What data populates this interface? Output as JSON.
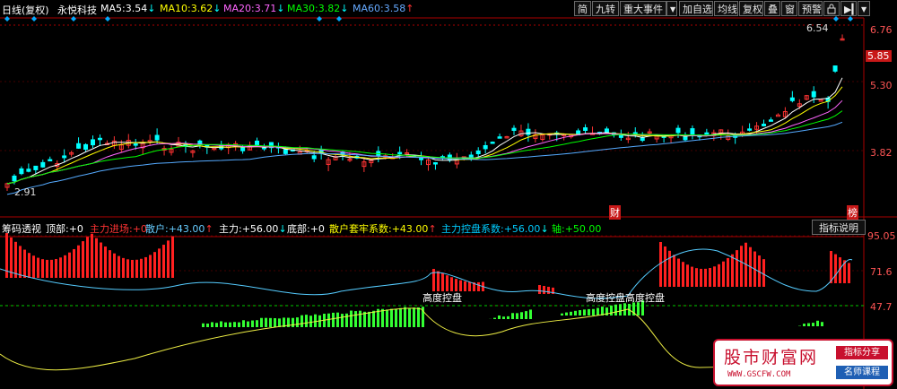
{
  "header": {
    "period": "日线(复权)",
    "stock": "永悦科技",
    "ma": [
      {
        "label": "MA5:",
        "value": "3.54",
        "arrow": "↓",
        "color": "#ffffff"
      },
      {
        "label": "MA10:",
        "value": "3.62",
        "arrow": "↓",
        "color": "#ffff00"
      },
      {
        "label": "MA20:",
        "value": "3.71",
        "arrow": "↓",
        "color": "#ff66ff"
      },
      {
        "label": "MA30:",
        "value": "3.82",
        "arrow": "↓",
        "color": "#00ff00"
      },
      {
        "label": "MA60:",
        "value": "3.58",
        "arrow": "↑",
        "color": "#66aaff"
      }
    ]
  },
  "toolbar": {
    "simplified": "简",
    "nine_turn": "九转",
    "major_events": "重大事件",
    "add_watch": "加自选",
    "ma_line": "均线",
    "restore": "复权",
    "overlay": "叠",
    "window": "窗",
    "warning": "预警"
  },
  "price_axis": {
    "top": "6.76",
    "current": "5.85",
    "mid": "5.30",
    "low": "3.82"
  },
  "price_notes": {
    "high": "6.54",
    "low": "2.91"
  },
  "event_marks": {
    "cai": "财",
    "bang": "榜"
  },
  "indicator": {
    "name": "筹码透视",
    "fields": [
      {
        "label": "顶部:",
        "value": "+0",
        "arrow": "",
        "color": "#ffffff"
      },
      {
        "label": "主力进场:",
        "value": "+0",
        "arrow": "",
        "color": "#ff3333"
      },
      {
        "label": "散户:",
        "value": "+43.00",
        "arrow": "↑",
        "color": "#66ccff"
      },
      {
        "label": "主力:",
        "value": "+56.00",
        "arrow": "↓",
        "color": "#ffffff"
      },
      {
        "label": "底部:",
        "value": "+0",
        "arrow": "",
        "color": "#ffffff"
      },
      {
        "label": "散户套牢系数:",
        "value": "+43.00",
        "arrow": "↑",
        "color": "#ffff00"
      },
      {
        "label": "主力控盘系数:",
        "value": "+56.00",
        "arrow": "↓",
        "color": "#00ccff"
      },
      {
        "label": "轴:",
        "value": "+50.00",
        "arrow": "",
        "color": "#00ff00"
      }
    ],
    "help": "指标说明",
    "axis": {
      "a": "95.05",
      "b": "71.6",
      "c": "47.7"
    },
    "annotations": {
      "first": "高度控盘",
      "second": "高度控盘高度控盘"
    }
  },
  "watermark": {
    "name": "股市财富网",
    "url": "WWW.GSCFW.COM",
    "tag1": "指标分享",
    "tag2": "名师课程"
  },
  "colors": {
    "up": "#ff3333",
    "down": "#00ffff",
    "ma5": "#ffffff",
    "ma10": "#ffff00",
    "ma20": "#ff66ff",
    "ma30": "#00ff00",
    "ma60": "#55aaff"
  }
}
